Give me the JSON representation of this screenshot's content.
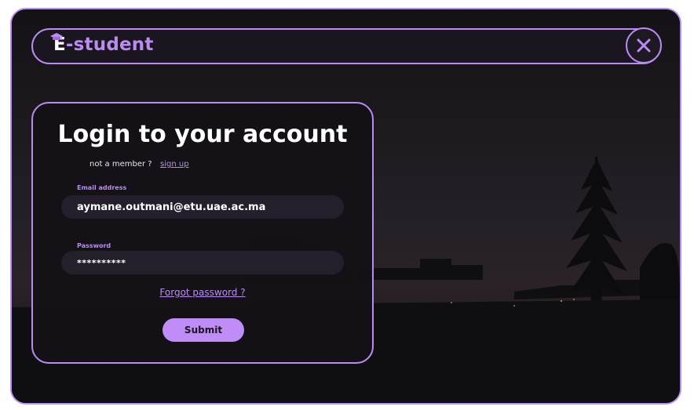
{
  "app": {
    "brand": "E-student",
    "brand_prefix": "E",
    "brand_suffix": "-student"
  },
  "header": {
    "close_icon": "close-icon"
  },
  "login": {
    "title": "Login to your account",
    "not_member_text": "not a member ?",
    "signup_label": "sign up",
    "email": {
      "label": "Email address",
      "value": "aymane.outmani@etu.uae.ac.ma"
    },
    "password": {
      "label": "Password",
      "value": "**********"
    },
    "forgot_label": "Forgot password ?",
    "submit_label": "Submit"
  },
  "colors": {
    "accent": "#b98cf2",
    "background": "#131115",
    "input_bg": "#241f2b",
    "button": "#bf8cf8"
  }
}
